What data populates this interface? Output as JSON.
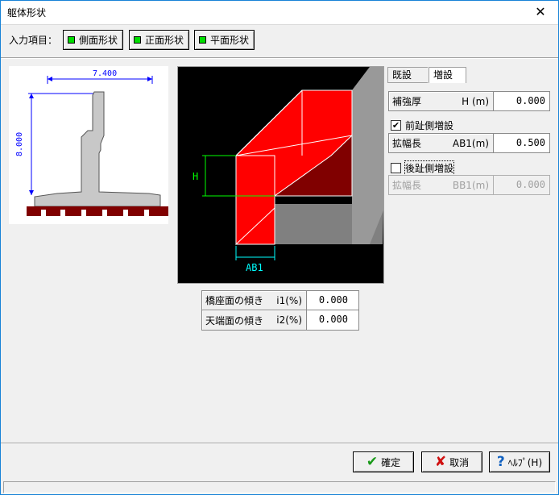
{
  "window": {
    "title": "躯体形状",
    "close_glyph": "✕"
  },
  "toolbar": {
    "label": "入力項目：",
    "buttons": [
      "側面形状",
      "正面形状",
      "平面形状"
    ]
  },
  "preview": {
    "width_dim": "7.400",
    "height_dim": "8.000"
  },
  "diagram": {
    "h_label": "H",
    "ab1_label": "AB1"
  },
  "tabs": {
    "existing": "既設",
    "added": "増設"
  },
  "fields": {
    "reinforce": {
      "label": "補強厚",
      "unit": "H (m)",
      "value": "0.000"
    },
    "front_check": {
      "label": "前趾側増設",
      "checked": true,
      "mark": "✔"
    },
    "front_widen": {
      "label": "拡幅長",
      "unit": "AB1(m)",
      "value": "0.500"
    },
    "back_check": {
      "label": "後趾側増設",
      "checked": false
    },
    "back_widen": {
      "label": "拡幅長",
      "unit": "BB1(m)",
      "value": "0.000"
    }
  },
  "slopes": [
    {
      "label": "橋座面の傾き",
      "unit": "i1(%)",
      "value": "0.000"
    },
    {
      "label": "天端面の傾き",
      "unit": "i2(%)",
      "value": "0.000"
    }
  ],
  "buttons": {
    "ok": {
      "label": "確定",
      "icon": "✔"
    },
    "cancel": {
      "label": "取消",
      "icon": "✘"
    },
    "help": {
      "label": "ﾍﾙﾌﾟ(H)",
      "icon": "?"
    }
  },
  "colors": {
    "accent_green": "#00dd00",
    "reinforce_red": "#ff0000",
    "dark_red": "#800000",
    "foundation": "#800000"
  }
}
